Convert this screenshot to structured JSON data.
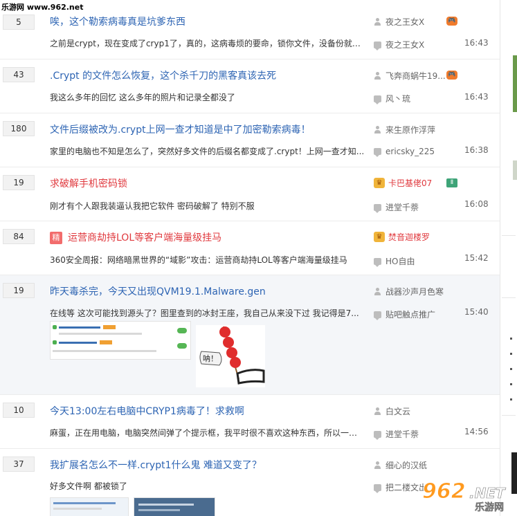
{
  "watermark": {
    "site": "乐游网 www.962.net"
  },
  "threads": [
    {
      "count": "5",
      "title": "唉，这个勒索病毒真是坑爹东西",
      "abstract": "之前是crypt，现在变成了cryp1了，真的，这病毒烦的要命，锁你文件，没备份就只...",
      "author": "夜之王女X",
      "last_reply": "夜之王女X",
      "time": "16:43",
      "badge": "🎮"
    },
    {
      "count": "43",
      "title": ".Crypt 的文件怎么恢复，这个杀千刀的黑客真该去死",
      "abstract": "我这么多年的回忆 这么多年的照片和记录全都没了",
      "author": "飞奔商蜗牛19...",
      "last_reply": "风丶琉",
      "time": "16:43",
      "badge": "🎮"
    },
    {
      "count": "180",
      "title": "文件后缀被改为.crypt上网一查才知道是中了加密勒索病毒！",
      "abstract": "家里的电脑也不知是怎么了，突然好多文件的后缀名都变成了.crypt！上网一查才知...",
      "author": "来生原作浮萍",
      "last_reply": "ericsky_225",
      "time": "16:38"
    },
    {
      "count": "19",
      "title": "求破解手机密码锁",
      "abstract": "刚才有个人跟我装逼认我把它软件 密码破解了 特别不服",
      "author": "卡巴基佬07",
      "last_reply": "进堂千萘",
      "time": "16:08",
      "badge": "Ⅱ"
    },
    {
      "count": "84",
      "title": "运营商劫持LOL等客户端海量级挂马",
      "tag": "精",
      "abstract": "360安全周报：网络暗黑世界的“域影”攻击：运营商劫持LOL等客户端海量级挂马",
      "author": "焚音迦楼罗",
      "last_reply": "HO自由",
      "time": "15:42"
    },
    {
      "count": "19",
      "title": "昨天毒杀完，今天又出现QVM19.1.Malware.gen",
      "abstract": "在线等 这次可能找到源头了？图里查到的冰封王座，我自己从来没下过 我记得是7...",
      "author": "战器沙声月色寒",
      "last_reply": "贴吧触点推广",
      "time": "15:40",
      "bubble": "呐！"
    },
    {
      "count": "10",
      "title": "今天13:00左右电脑中CRYP1病毒了！求救啊",
      "abstract": "麻蛋，正在用电脑，电脑突然间弹了个提示框，我平时很不喜欢这种东西，所以一直...",
      "author": "白文云",
      "last_reply": "进堂千萘",
      "time": "14:56"
    },
    {
      "count": "37",
      "title": "我扩展名怎么不一样.crypt1什么鬼 难道又变了？",
      "abstract": "好多文件啊 都被锁了",
      "author": "细心的汉纸",
      "last_reply": "把二楼文出",
      "time": ""
    }
  ],
  "logo": {
    "text1": "962",
    "text2": ".NET",
    "text3": "乐游网"
  },
  "colors": {
    "link": "#2d64b3",
    "red": "#e0393e",
    "highlight": "#f4f6f9"
  }
}
